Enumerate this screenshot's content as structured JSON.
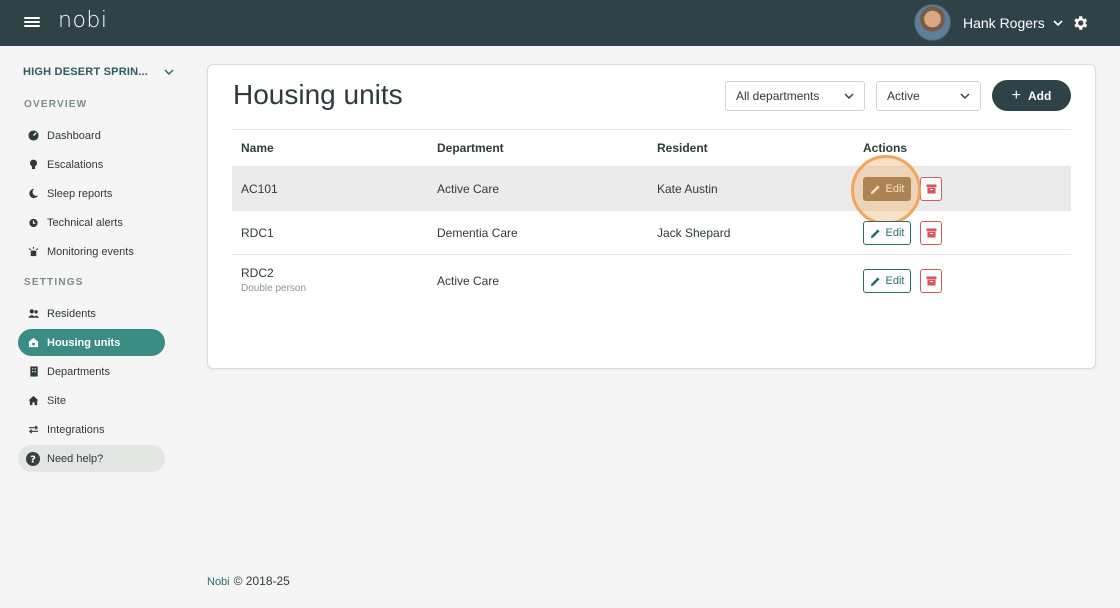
{
  "app": {
    "logo": "nobi"
  },
  "topbar": {
    "user_name": "Hank Rogers"
  },
  "sidebar": {
    "site_name": "HIGH DESERT SPRIN...",
    "sections": {
      "overview": "OVERVIEW",
      "settings": "SETTINGS"
    },
    "overview_items": [
      {
        "label": "Dashboard",
        "icon": "dashboard-icon"
      },
      {
        "label": "Escalations",
        "icon": "lightbulb-icon"
      },
      {
        "label": "Sleep reports",
        "icon": "moon-icon"
      },
      {
        "label": "Technical alerts",
        "icon": "alarm-clock-icon"
      },
      {
        "label": "Monitoring events",
        "icon": "broadcast-icon"
      }
    ],
    "settings_items": [
      {
        "label": "Residents",
        "icon": "users-icon"
      },
      {
        "label": "Housing units",
        "icon": "house-icon",
        "active": true
      },
      {
        "label": "Departments",
        "icon": "building-icon"
      },
      {
        "label": "Site",
        "icon": "home-icon"
      },
      {
        "label": "Integrations",
        "icon": "arrows-icon"
      }
    ],
    "help": {
      "label": "Need help?",
      "icon": "question-icon"
    }
  },
  "main": {
    "title": "Housing units",
    "filters": {
      "department": "All departments",
      "status": "Active"
    },
    "add_label": "Add",
    "columns": [
      "Name",
      "Department",
      "Resident",
      "Actions"
    ],
    "rows": [
      {
        "name": "AC101",
        "subtitle": "",
        "department": "Active Care",
        "resident": "Kate Austin"
      },
      {
        "name": "RDC1",
        "subtitle": "",
        "department": "Dementia Care",
        "resident": "Jack Shepard"
      },
      {
        "name": "RDC2",
        "subtitle": "Double person",
        "department": "Active Care",
        "resident": ""
      }
    ],
    "edit_label": "Edit"
  },
  "footer": {
    "brand": "Nobi",
    "copyright": "© 2018-25"
  },
  "colors": {
    "topbar": "#2e4247",
    "accent": "#3a8c85",
    "danger": "#d6585a",
    "highlight": "#f2a55a"
  }
}
